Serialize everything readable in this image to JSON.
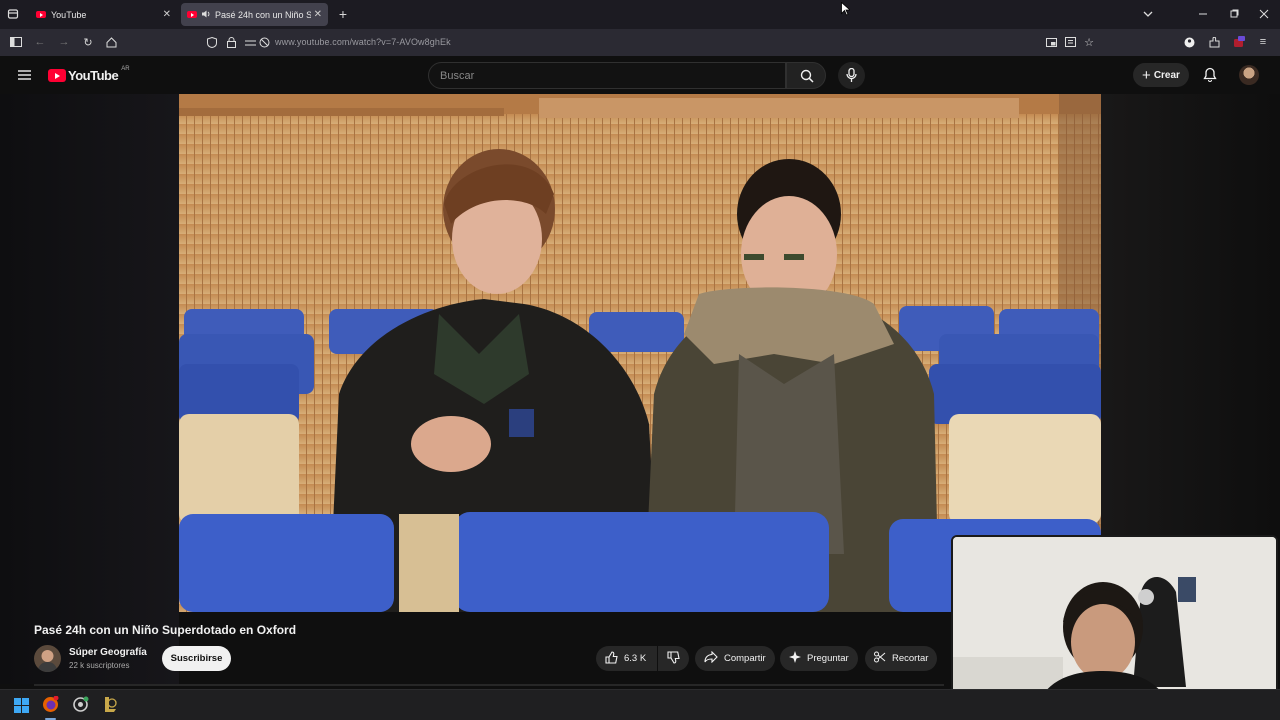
{
  "browser": {
    "tabs": [
      {
        "label": "YouTube",
        "active": false
      },
      {
        "label": "Pasé 24h con un Niño Superdotado en Oxford",
        "active": true
      }
    ],
    "new_tab": "+",
    "url": "www.youtube.com/watch?v=7-AVOw8ghEk"
  },
  "youtube": {
    "logo_text": "YouTube",
    "region": "AR",
    "search_placeholder": "Buscar",
    "create_label": "Crear"
  },
  "video": {
    "title": "Pasé 24h con un Niño Superdotado en Oxford",
    "channel_name": "Súper Geografía",
    "subscribers": "22 k suscriptores",
    "subscribe_label": "Suscribirse",
    "likes": "6.3 K",
    "share_label": "Compartir",
    "ask_label": "Preguntar",
    "clip_label": "Recortar"
  },
  "colors": {
    "yt_red": "#ff0033",
    "background": "#0f0f0f",
    "pill": "#272727"
  }
}
